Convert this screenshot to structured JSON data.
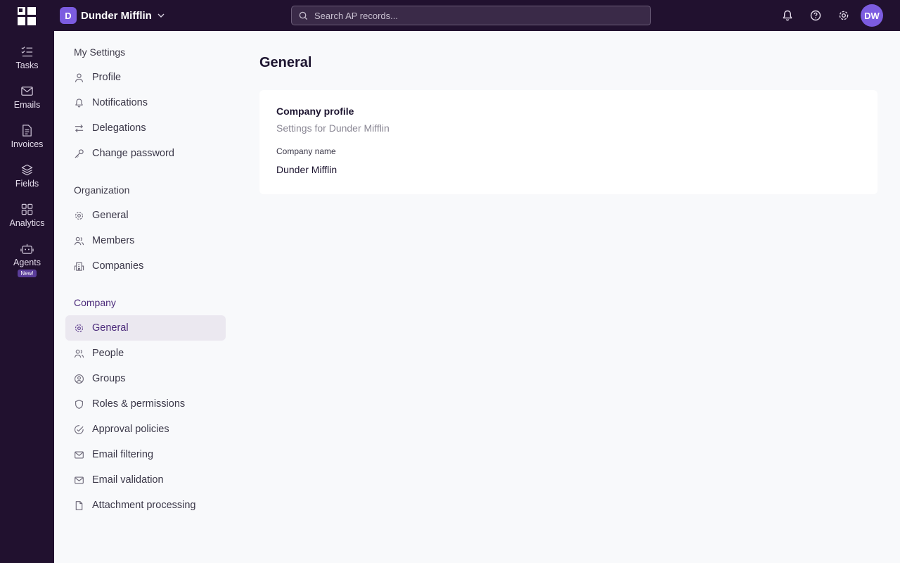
{
  "topbar": {
    "org_initial": "D",
    "org_name": "Dunder Mifflin",
    "search_placeholder": "Search AP records...",
    "avatar_initials": "DW"
  },
  "rail": {
    "items": [
      {
        "label": "Tasks",
        "icon": "tasks-icon"
      },
      {
        "label": "Emails",
        "icon": "mail-icon"
      },
      {
        "label": "Invoices",
        "icon": "document-icon"
      },
      {
        "label": "Fields",
        "icon": "layers-icon"
      },
      {
        "label": "Analytics",
        "icon": "grid-icon"
      },
      {
        "label": "Agents",
        "icon": "robot-icon"
      }
    ],
    "new_badge": "New!"
  },
  "settings_nav": {
    "my_settings": {
      "title": "My Settings",
      "items": [
        "Profile",
        "Notifications",
        "Delegations",
        "Change password"
      ]
    },
    "organization": {
      "title": "Organization",
      "items": [
        "General",
        "Members",
        "Companies"
      ]
    },
    "company": {
      "title": "Company",
      "items": [
        "General",
        "People",
        "Groups",
        "Roles & permissions",
        "Approval policies",
        "Email filtering",
        "Email validation",
        "Attachment processing"
      ]
    }
  },
  "main": {
    "title": "General",
    "card": {
      "title": "Company profile",
      "subtitle": "Settings for Dunder Mifflin",
      "field_label": "Company name",
      "field_value": "Dunder Mifflin"
    }
  },
  "colors": {
    "sidebar_bg": "#21112f",
    "accent": "#7c5ce0",
    "active_text": "#4b2a7a",
    "selected_bg": "#ebe8f0"
  }
}
